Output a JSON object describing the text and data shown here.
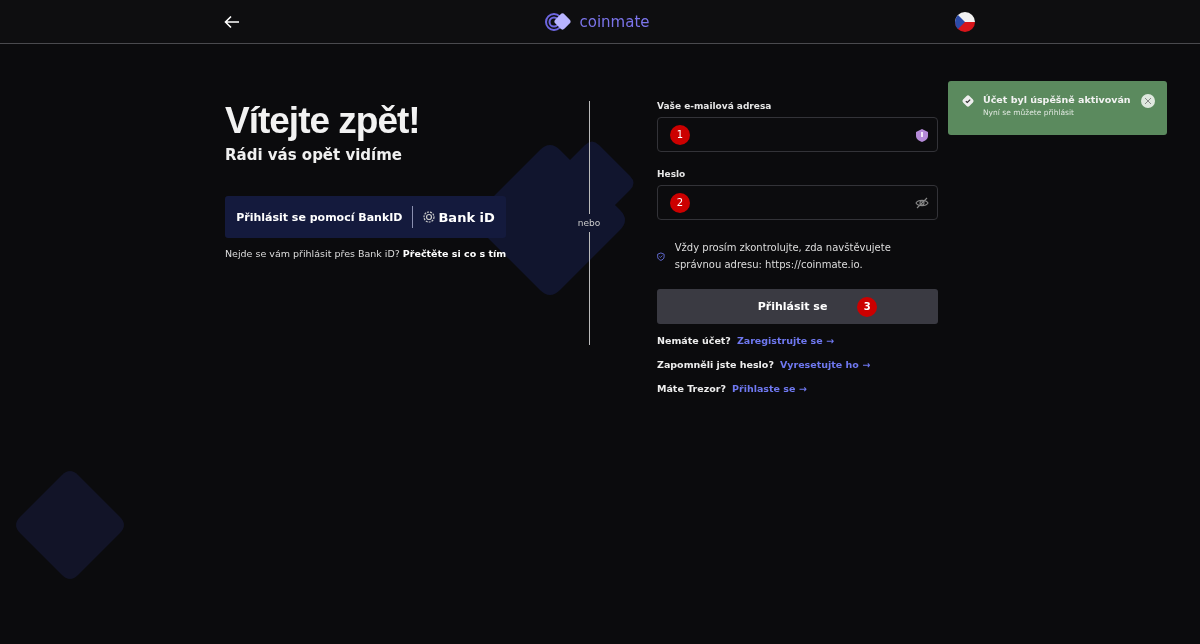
{
  "header": {
    "logo_text": "coinmate"
  },
  "welcome": {
    "title": "Vítejte zpět!",
    "subtitle": "Rádi vás opět vidíme",
    "bankid_button": "Přihlásit se pomocí BankID",
    "bankid_logo_text": "Bank iD",
    "help_text": "Nejde se vám přihlásit přes Bank iD? **Přečtěte si co s tím**"
  },
  "divider_label": "nebo",
  "form": {
    "fields": [
      {
        "label": "Vaše e-mailová adresa",
        "marker": "1",
        "kind": "email"
      },
      {
        "label": "Heslo",
        "marker": "2",
        "kind": "password"
      }
    ],
    "notice": "Vždy prosím zkontrolujte, zda navštěvujete správnou adresu: https://coinmate.io.",
    "submit": {
      "label": "Přihlásit se",
      "marker": "3"
    },
    "links": [
      {
        "question": "Nemáte účet?",
        "link": "Zaregistrujte se →"
      },
      {
        "question": "Zapomněli jste heslo?",
        "link": "Vyresetujte ho →"
      },
      {
        "question": "Máte Trezor?",
        "link": "Přihlaste se →"
      }
    ]
  },
  "toast": {
    "title": "Účet byl úspěšně aktivován",
    "message": "Nyní se můžete přihlásit"
  }
}
